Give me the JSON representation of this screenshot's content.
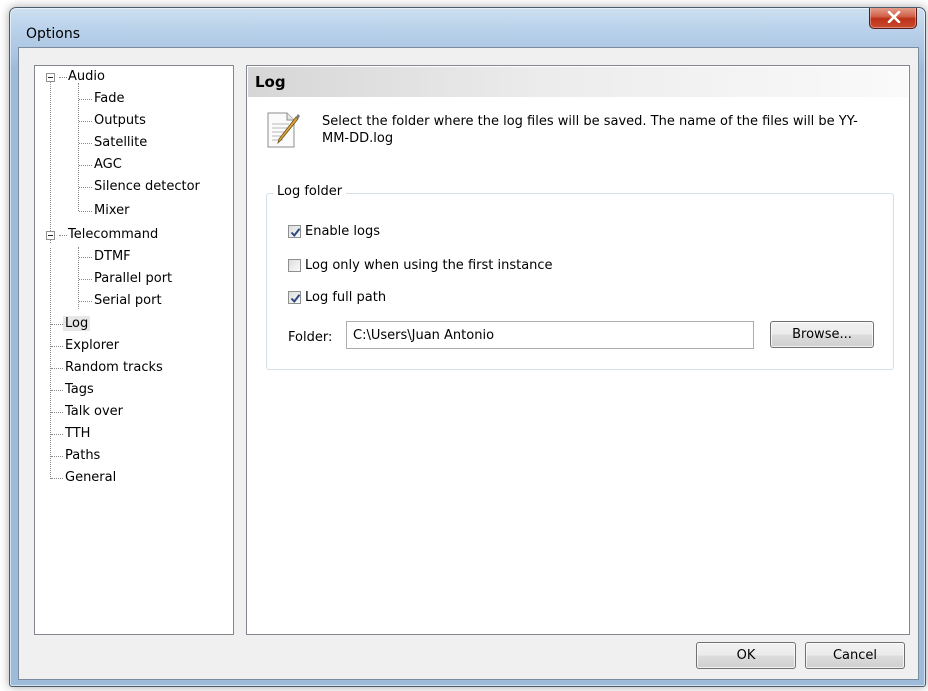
{
  "window": {
    "title": "Options"
  },
  "tree": {
    "items": [
      {
        "label": "Audio",
        "level": 0,
        "expanded": true
      },
      {
        "label": "Fade",
        "level": 1
      },
      {
        "label": "Outputs",
        "level": 1
      },
      {
        "label": "Satellite",
        "level": 1
      },
      {
        "label": "AGC",
        "level": 1
      },
      {
        "label": "Silence detector",
        "level": 1
      },
      {
        "label": "Mixer",
        "level": 1
      },
      {
        "label": "Telecommand",
        "level": 0,
        "expanded": true
      },
      {
        "label": "DTMF",
        "level": 1
      },
      {
        "label": "Parallel port",
        "level": 1
      },
      {
        "label": "Serial port",
        "level": 1
      },
      {
        "label": "Log",
        "level": 0,
        "selected": true
      },
      {
        "label": "Explorer",
        "level": 0
      },
      {
        "label": "Random tracks",
        "level": 0
      },
      {
        "label": "Tags",
        "level": 0
      },
      {
        "label": "Talk over",
        "level": 0
      },
      {
        "label": "TTH",
        "level": 0
      },
      {
        "label": "Paths",
        "level": 0
      },
      {
        "label": "General",
        "level": 0
      }
    ]
  },
  "panel": {
    "title": "Log",
    "description": "Select the folder where the log files will be saved. The name of the files will be YY-MM-DD.log",
    "group": {
      "legend": "Log folder",
      "options": [
        {
          "label": "Enable logs",
          "checked": true
        },
        {
          "label": "Log only when using the first instance",
          "checked": false
        },
        {
          "label": "Log full path",
          "checked": true
        }
      ],
      "folder_label": "Folder:",
      "folder_value": "C:\\Users\\Juan Antonio",
      "browse_label": "Browse..."
    }
  },
  "buttons": {
    "ok": "OK",
    "cancel": "Cancel"
  },
  "colors": {
    "close_button": "#c94a2e",
    "title_bar": "#b9d1ea",
    "selection": "#e7e7e7"
  },
  "icons": {
    "close": "close-icon",
    "notepad": "notepad-pen-icon"
  }
}
